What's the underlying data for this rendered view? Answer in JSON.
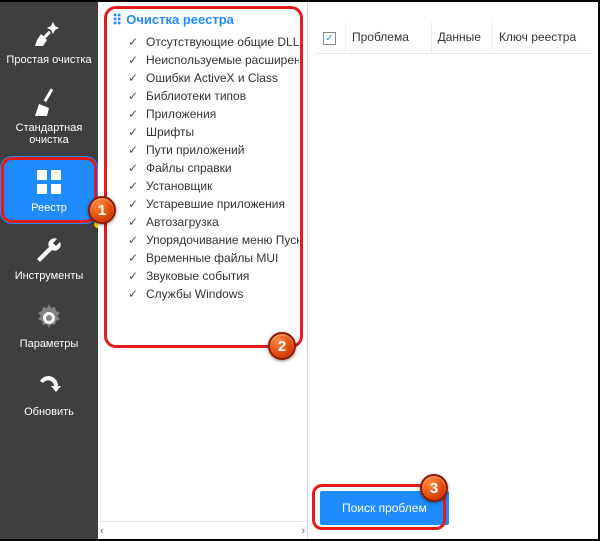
{
  "sidebar": {
    "items": [
      {
        "label": "Простая очистка",
        "icon": "broom-spark"
      },
      {
        "label": "Стандартная очистка",
        "icon": "broom"
      },
      {
        "label": "Реестр",
        "icon": "grid",
        "active": true,
        "highlighted": true
      },
      {
        "label": "Инструменты",
        "icon": "wrench"
      },
      {
        "label": "Параметры",
        "icon": "gear"
      },
      {
        "label": "Обновить",
        "icon": "refresh"
      }
    ]
  },
  "checklist": {
    "title": "Очистка реестра",
    "items": [
      "Отсутствующие общие DLL",
      "Неиспользуемые расширения ф…",
      "Ошибки ActiveX и Class",
      "Библиотеки типов",
      "Приложения",
      "Шрифты",
      "Пути приложений",
      "Файлы справки",
      "Установщик",
      "Устаревшие приложения",
      "Автозагрузка",
      "Упорядочивание меню Пуск",
      "Временные файлы MUI",
      "Звуковые события",
      "Службы Windows"
    ]
  },
  "grid": {
    "columns": [
      "Проблема",
      "Данные",
      "Ключ реестра"
    ]
  },
  "footer": {
    "search_button": "Поиск проблем"
  },
  "callouts": [
    "1",
    "2",
    "3"
  ]
}
